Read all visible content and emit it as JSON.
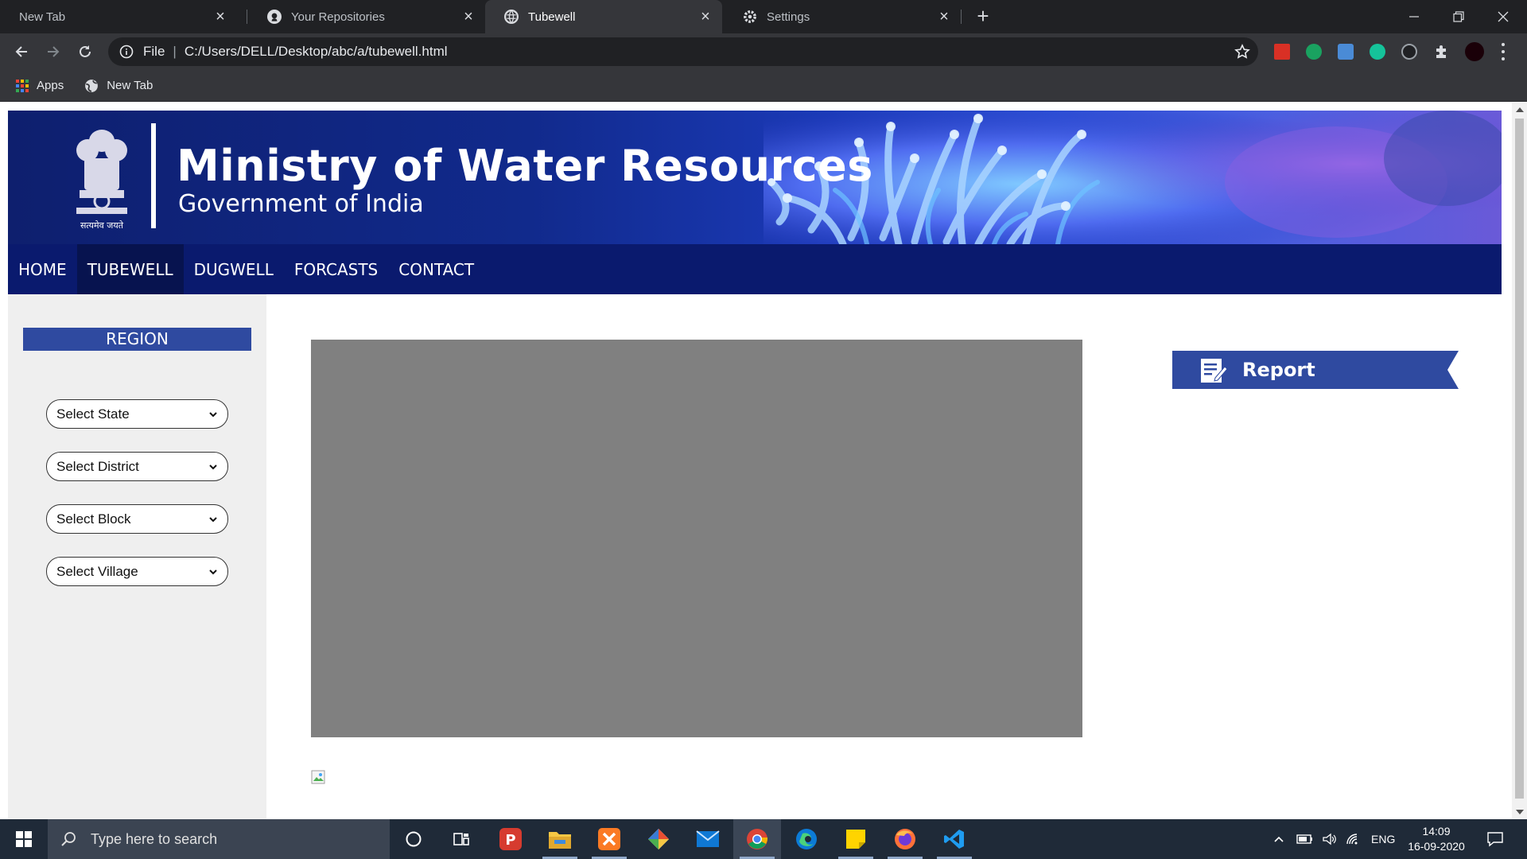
{
  "browser": {
    "tabs": [
      {
        "title": "New Tab",
        "active": false
      },
      {
        "title": "Your Repositories",
        "active": false
      },
      {
        "title": "Tubewell",
        "active": true
      },
      {
        "title": "Settings",
        "active": false
      }
    ],
    "address": {
      "scheme_label": "File",
      "url": "C:/Users/DELL/Desktop/abc/a/tubewell.html"
    },
    "bookmarks": [
      {
        "label": "Apps",
        "icon": "apps-grid-icon"
      },
      {
        "label": "New Tab",
        "icon": "globe-icon"
      }
    ]
  },
  "site": {
    "title": "Ministry of Water Resources",
    "subtitle": "Government of India",
    "emblem_caption": "सत्यमेव जयते",
    "nav": [
      "HOME",
      "TUBEWELL",
      "DUGWELL",
      "FORCASTS",
      "CONTACT"
    ],
    "active_nav": "TUBEWELL",
    "sidebar": {
      "heading": "REGION",
      "selects": [
        {
          "value": "Select State"
        },
        {
          "value": "Select District"
        },
        {
          "value": "Select Block"
        },
        {
          "value": "Select Village"
        }
      ]
    },
    "report_label": "Report",
    "colors": {
      "nav_bg": "#0a1a6e",
      "region_bg": "#2f4aa0",
      "report_bg": "#2f4aa0",
      "map_placeholder": "#808080"
    }
  },
  "taskbar": {
    "search_placeholder": "Type here to search",
    "language": "ENG",
    "time": "14:09",
    "date": "16-09-2020"
  }
}
